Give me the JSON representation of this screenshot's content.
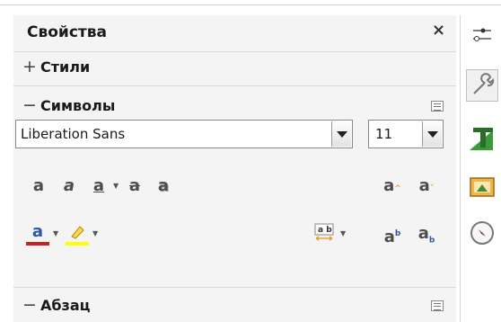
{
  "panel": {
    "title": "Свойства",
    "close_glyph": "×"
  },
  "sections": {
    "styles": {
      "sign": "+",
      "label": "Стили",
      "state": "collapsed"
    },
    "symbols": {
      "sign": "−",
      "label": "Символы",
      "state": "expanded"
    },
    "paragraph": {
      "sign": "−",
      "label": "Абзац",
      "state": "expanded"
    }
  },
  "symbols": {
    "font_name": "Liberation Sans",
    "font_size": "11",
    "format_row1": [
      "bold-icon",
      "italic-icon",
      "underline-icon",
      "strikethrough-icon",
      "shadow-icon",
      "grow-font-icon",
      "shrink-font-icon"
    ],
    "format_row2": [
      "font-color-icon",
      "highlight-color-icon",
      "character-spacing-icon",
      "superscript-icon",
      "subscript-icon"
    ]
  },
  "sidebar": {
    "tabs": [
      "properties-icon",
      "styles-icon",
      "gallery-icon",
      "navigator-icon"
    ],
    "selected": "properties-icon"
  },
  "colors": {
    "font_color": "#c9211e",
    "highlight_color": "#ffff00",
    "accent_green": "#2e8b2e",
    "accent_orange": "#e8a32e"
  }
}
